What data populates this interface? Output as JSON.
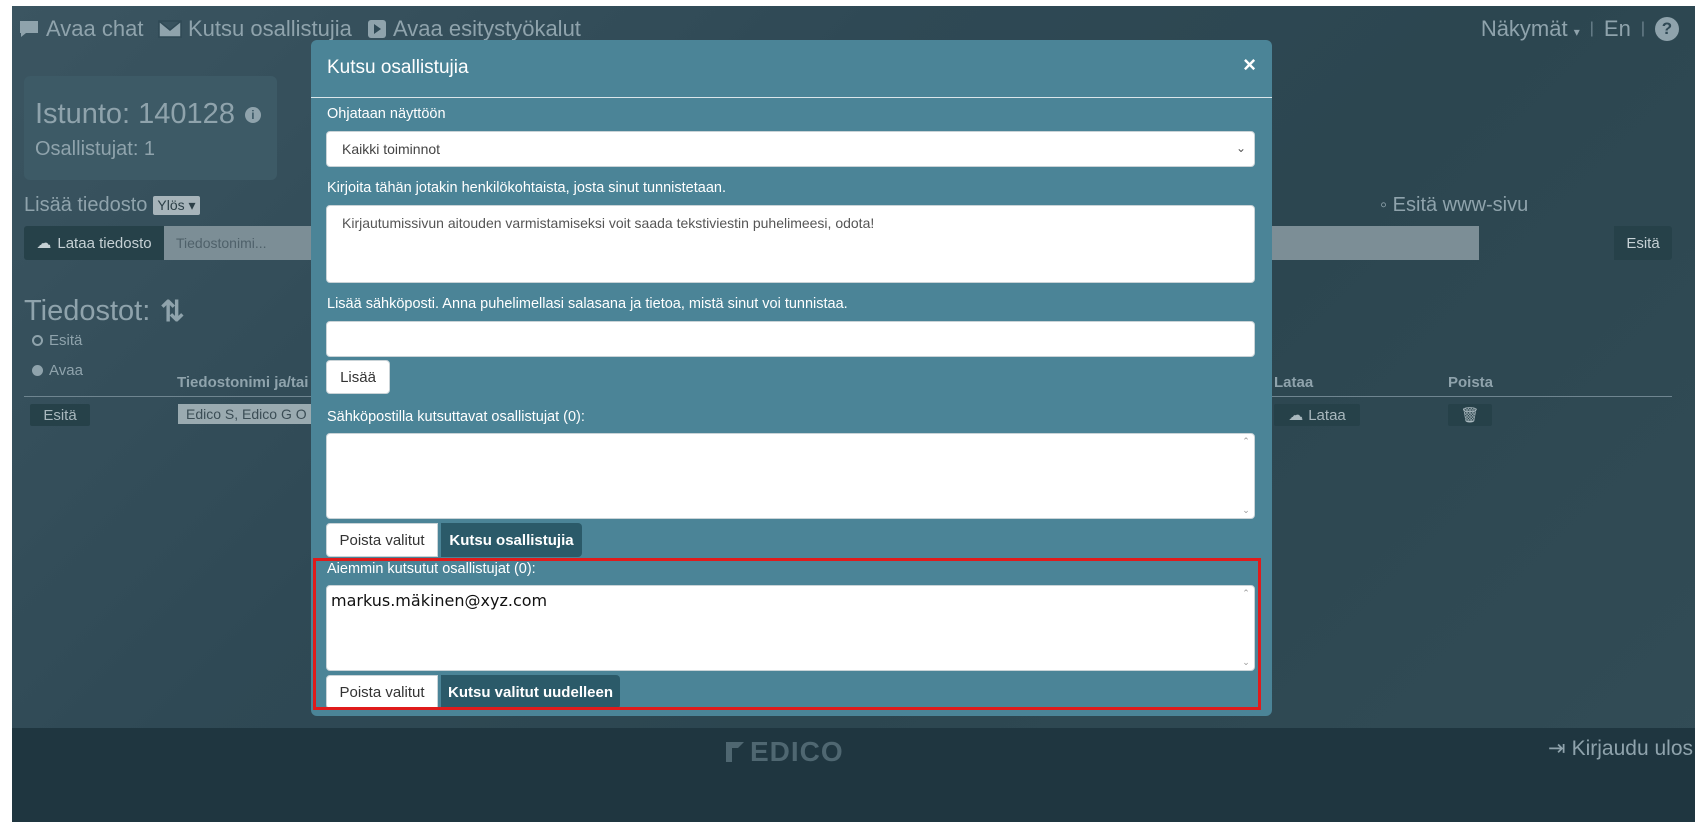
{
  "topnav": {
    "open_chat": "Avaa chat",
    "invite": "Kutsu osallistujia",
    "open_tools": "Avaa esitystyökalut",
    "views": "Näkymät",
    "lang": "En",
    "sep": "|",
    "help": "?"
  },
  "session": {
    "title": "Istunto: 140128",
    "participants": "Osallistujat: 1",
    "info": "i"
  },
  "add_file": {
    "label": "Lisää tiedosto",
    "order": "Ylös",
    "present_web": "Esitä www-sivu",
    "upload_button": "Lataa tiedosto",
    "filename_placeholder": "Tiedostonimi...",
    "present_button": "Esitä"
  },
  "files": {
    "title": "Tiedostot:",
    "radio_present": "Esitä",
    "radio_open": "Avaa",
    "col_filename": "Tiedostonimi ja/tai",
    "col_download": "Lataa",
    "col_delete": "Poista",
    "row_present": "Esitä",
    "row_filename": "Edico S, Edico G O",
    "row_download": "Lataa"
  },
  "footer": {
    "logo": "EDICO",
    "logout": "Kirjaudu ulos"
  },
  "modal": {
    "title": "Kutsu osallistujia",
    "close": "×",
    "redirect_label": "Ohjataan näyttöön",
    "redirect_value": "Kaikki toiminnot",
    "personal_label": "Kirjoita tähän jotakin henkilökohtaista, josta sinut tunnistetaan.",
    "personal_text": "Kirjautumissivun aitouden varmistamiseksi voit saada tekstiviestin puhelimeesi, odota!",
    "email_label": "Lisää sähköposti. Anna puhelimellasi salasana ja tietoa, mistä sinut voi tunnistaa.",
    "add_button": "Lisää",
    "invitees_label": "Sähköpostilla kutsuttavat osallistujat (0):",
    "remove_selected": "Poista valitut",
    "invite_button": "Kutsu osallistujia",
    "previous_label": "Aiemmin kutsutut osallistujat (0):",
    "previous_items": [
      "markus.mäkinen@xyz.com"
    ],
    "remove_selected_2": "Poista valitut",
    "reinvite_button": "Kutsu valitut uudelleen"
  },
  "colors": {
    "modal_bg": "#4b8497",
    "dark_button": "#2b5a69",
    "highlight": "#e01b1b"
  }
}
